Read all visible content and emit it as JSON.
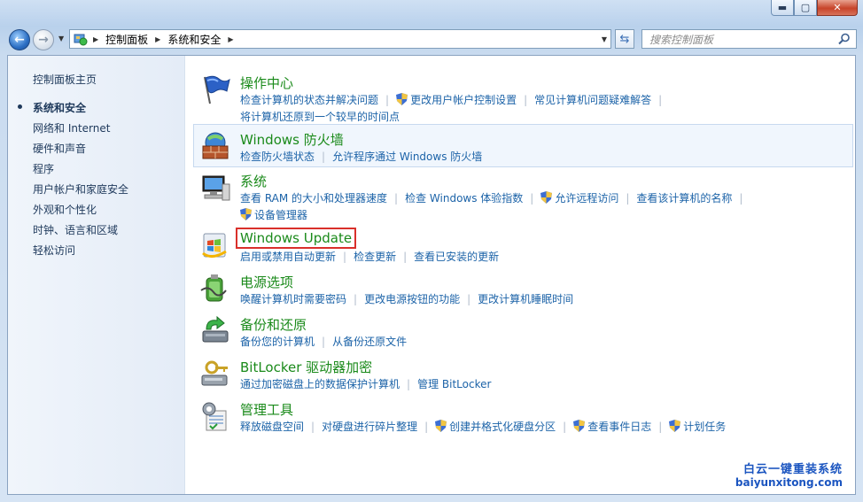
{
  "window": {
    "caption_min": "▬",
    "caption_max": "▢",
    "caption_close": "✕"
  },
  "nav": {
    "breadcrumb": [
      "控制面板",
      "系统和安全"
    ],
    "search_placeholder": "搜索控制面板"
  },
  "sidebar": {
    "home": "控制面板主页",
    "items": [
      {
        "label": "系统和安全",
        "active": true
      },
      {
        "label": "网络和 Internet"
      },
      {
        "label": "硬件和声音"
      },
      {
        "label": "程序"
      },
      {
        "label": "用户帐户和家庭安全"
      },
      {
        "label": "外观和个性化"
      },
      {
        "label": "时钟、语言和区域"
      },
      {
        "label": "轻松访问"
      }
    ]
  },
  "categories": [
    {
      "title": "操作中心",
      "icon": "flag-icon",
      "links": [
        [
          "检查计算机的状态并解决问题",
          "更改用户帐户控制设置",
          "常见计算机问题疑难解答"
        ],
        [
          "将计算机还原到一个较早的时间点"
        ]
      ]
    },
    {
      "title": "Windows 防火墙",
      "icon": "firewall-icon",
      "links": [
        [
          "检查防火墙状态",
          "允许程序通过 Windows 防火墙"
        ]
      ]
    },
    {
      "title": "系统",
      "icon": "computer-icon",
      "links": [
        [
          "查看 RAM 的大小和处理器速度",
          "检查 Windows 体验指数",
          "允许远程访问",
          "查看该计算机的名称"
        ],
        [
          "设备管理器"
        ]
      ]
    },
    {
      "title": "Windows Update",
      "icon": "windows-update-icon",
      "links": [
        [
          "启用或禁用自动更新",
          "检查更新",
          "查看已安装的更新"
        ]
      ]
    },
    {
      "title": "电源选项",
      "icon": "battery-icon",
      "links": [
        [
          "唤醒计算机时需要密码",
          "更改电源按钮的功能",
          "更改计算机睡眠时间"
        ]
      ]
    },
    {
      "title": "备份和还原",
      "icon": "backup-icon",
      "links": [
        [
          "备份您的计算机",
          "从备份还原文件"
        ]
      ]
    },
    {
      "title": "BitLocker 驱动器加密",
      "icon": "bitlocker-icon",
      "links": [
        [
          "通过加密磁盘上的数据保护计算机",
          "管理 BitLocker"
        ]
      ]
    },
    {
      "title": "管理工具",
      "icon": "admin-tools-icon",
      "links": [
        [
          "释放磁盘空间",
          "对硬盘进行碎片整理",
          "创建并格式化硬盘分区",
          "查看事件日志",
          "计划任务"
        ]
      ]
    }
  ],
  "watermark": {
    "line1": "白云一键重装系统",
    "line2": "baiyunxitong.com"
  }
}
